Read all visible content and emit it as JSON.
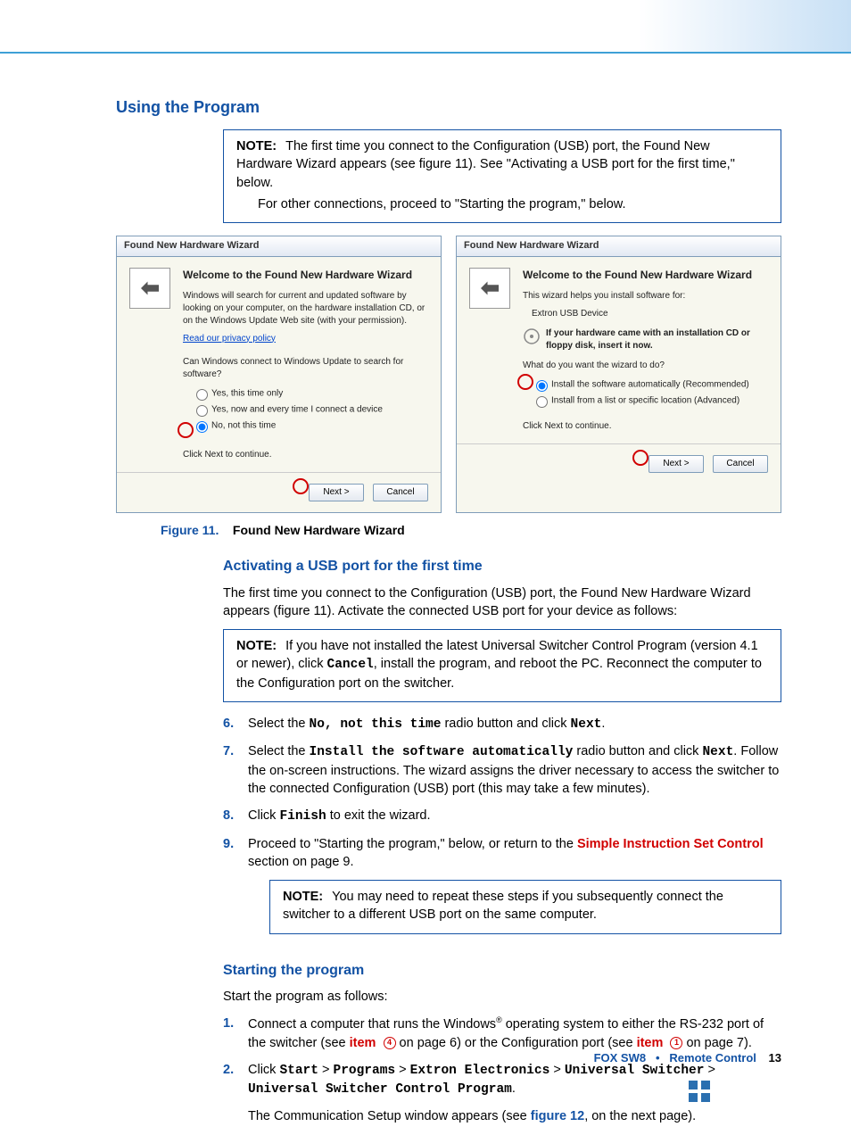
{
  "heading1": "Using the Program",
  "note1": {
    "label": "NOTE:",
    "line1": "The first time you connect to the Configuration (USB) port, the Found New Hardware Wizard appears (see figure 11).  See \"Activating a USB port for the first time,\" below.",
    "line2": "For other connections, proceed to \"Starting the program,\" below."
  },
  "wizard": {
    "title": "Found New Hardware Wizard",
    "left": {
      "heading": "Welcome to the Found New Hardware Wizard",
      "p1": "Windows will search for current and updated software by looking on your computer, on the hardware installation CD, or on the Windows Update Web site (with your permission).",
      "link": "Read our privacy policy",
      "p2": "Can Windows connect to Windows Update to search for software?",
      "r1": "Yes, this time only",
      "r2": "Yes, now and every time I connect a device",
      "r3": "No, not this time",
      "foot": "Click Next to continue.",
      "btn_next": "Next >",
      "btn_cancel": "Cancel"
    },
    "right": {
      "heading": "Welcome to the Found New Hardware Wizard",
      "p1": "This wizard helps you install software for:",
      "device": "Extron USB Device",
      "cd": "If your hardware came with an installation CD or floppy disk, insert it now.",
      "p2": "What do you want the wizard to do?",
      "r1": "Install the software automatically (Recommended)",
      "r2": "Install from a list or specific location (Advanced)",
      "foot": "Click Next to continue.",
      "btn_next": "Next >",
      "btn_cancel": "Cancel"
    }
  },
  "caption": {
    "fig": "Figure 11.",
    "txt": "Found New Hardware Wizard"
  },
  "heading2": "Activating a USB port for the first time",
  "p_act": "The first time you connect to the Configuration (USB) port, the Found New Hardware Wizard appears (figure 11).  Activate the connected USB port for your device as follows:",
  "note2": {
    "label": "NOTE:",
    "line1a": "If you have not installed the latest Universal Switcher Control Program (version 4.1 or newer), click ",
    "cancel": "Cancel",
    "line1b": ", install the program, and reboot the PC. Reconnect the computer to the Configuration port on the switcher."
  },
  "steps_a": {
    "s6a": "Select the ",
    "s6b": "No, not this time",
    "s6c": " radio button and click ",
    "s6d": "Next",
    "s6e": ".",
    "s7a": "Select the ",
    "s7b": "Install the software automatically",
    "s7c": " radio button and click ",
    "s7d": "Next",
    "s7e": ". Follow the on-screen instructions. The wizard assigns the driver necessary to access the switcher to the connected Configuration (USB) port (this may take a few minutes).",
    "s8a": "Click ",
    "s8b": "Finish",
    "s8c": " to exit the wizard.",
    "s9a": "Proceed to \"Starting the program,\" below, or return to the ",
    "s9link": "Simple Instruction Set Control",
    "s9b": " section on page 9."
  },
  "note3": {
    "label": "NOTE:",
    "text": "You may need to repeat these steps if you subsequently connect the switcher to a different USB port on the same computer."
  },
  "heading3": "Starting the program",
  "p_start": "Start the program as follows:",
  "steps_b": {
    "s1a": "Connect a computer that runs the Windows",
    "reg": "®",
    "s1b": " operating system to either the RS-232 port of the switcher (see ",
    "item1": "item",
    "circ1": "4",
    "s1c": " on page 6) or the Configuration port (see ",
    "item2": "item",
    "circ2": "1",
    "s1d": " on page 7).",
    "s2a": "Click ",
    "start": "Start",
    "gt": " > ",
    "programs": "Programs",
    "extron": "Extron Electronics",
    "usw": "Universal Switcher",
    "uswcp": "Universal Switcher Control Program",
    "s2b": ".",
    "s2c_a": "The Communication Setup window appears (see ",
    "fig12": "figure 12",
    "s2c_b": ", on the next page)."
  },
  "footer": {
    "product": "FOX SW8",
    "bullet": "•",
    "section": "Remote Control",
    "page": "13"
  }
}
